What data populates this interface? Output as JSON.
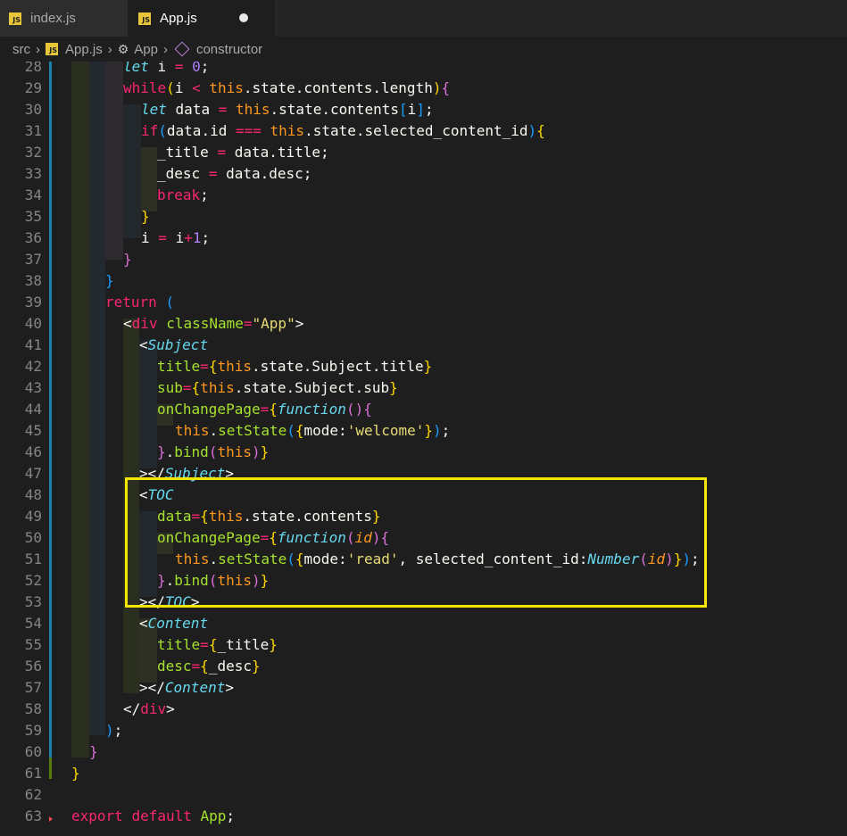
{
  "tabs": [
    {
      "label": "index.js",
      "icon": "js-file-icon"
    },
    {
      "label": "App.js",
      "icon": "js-file-icon",
      "modified": true
    }
  ],
  "breadcrumb": {
    "items": [
      "src",
      "App.js",
      "App",
      "constructor"
    ]
  },
  "editor": {
    "lines": [
      {
        "n": "28"
      },
      {
        "n": "29"
      },
      {
        "n": "30"
      },
      {
        "n": "31"
      },
      {
        "n": "32"
      },
      {
        "n": "33"
      },
      {
        "n": "34"
      },
      {
        "n": "35"
      },
      {
        "n": "36"
      },
      {
        "n": "37"
      },
      {
        "n": "38"
      },
      {
        "n": "39"
      },
      {
        "n": "40"
      },
      {
        "n": "41"
      },
      {
        "n": "42"
      },
      {
        "n": "43"
      },
      {
        "n": "44"
      },
      {
        "n": "45"
      },
      {
        "n": "46"
      },
      {
        "n": "47"
      },
      {
        "n": "48"
      },
      {
        "n": "49"
      },
      {
        "n": "50"
      },
      {
        "n": "51"
      },
      {
        "n": "52"
      },
      {
        "n": "53"
      },
      {
        "n": "54"
      },
      {
        "n": "55"
      },
      {
        "n": "56"
      },
      {
        "n": "57"
      },
      {
        "n": "58"
      },
      {
        "n": "59"
      },
      {
        "n": "60"
      },
      {
        "n": "61"
      },
      {
        "n": "62"
      },
      {
        "n": "63"
      }
    ]
  },
  "colors": {
    "background": "#1e1e1e",
    "highlight_box": "#f3e600"
  }
}
